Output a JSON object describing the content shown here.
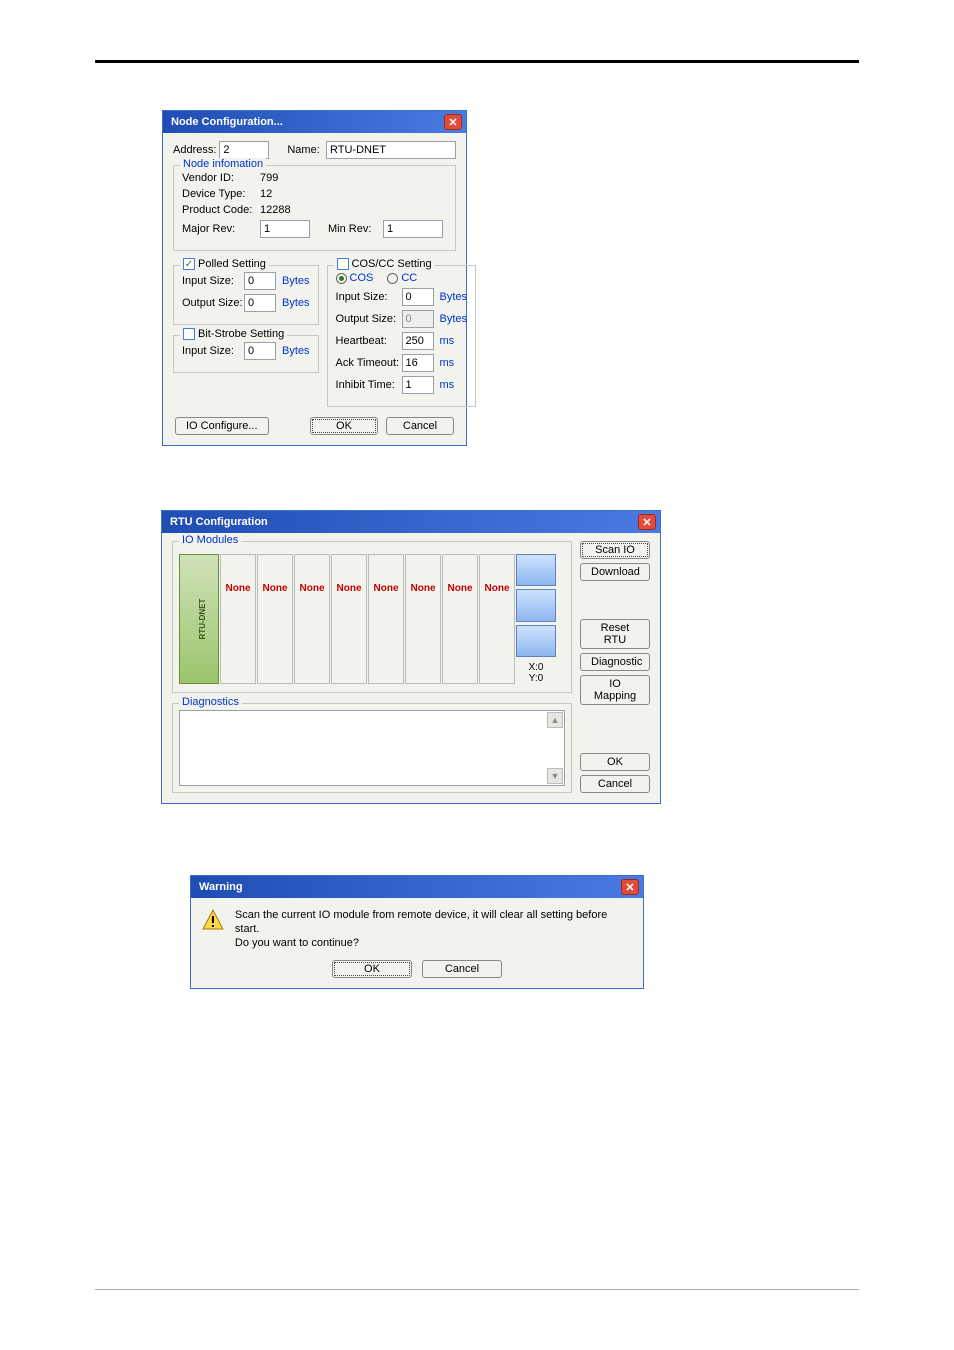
{
  "nodecfg": {
    "title": "Node Configuration...",
    "addressLabel": "Address:",
    "addressValue": "2",
    "nameLabel": "Name:",
    "nameValue": "RTU-DNET",
    "nodeInfoLegend": "Node infomation",
    "vendorIdLabel": "Vendor ID:",
    "vendorIdValue": "799",
    "deviceTypeLabel": "Device Type:",
    "deviceTypeValue": "12",
    "productCodeLabel": "Product Code:",
    "productCodeValue": "12288",
    "majorRevLabel": "Major Rev:",
    "majorRevValue": "1",
    "minRevLabel": "Min Rev:",
    "minRevValue": "1",
    "polled": {
      "legend": "Polled Setting",
      "checked": true,
      "inputSizeLabel": "Input Size:",
      "inputSizeValue": "0",
      "outputSizeLabel": "Output Size:",
      "outputSizeValue": "0",
      "unit": "Bytes"
    },
    "bitstrobe": {
      "legend": "Bit-Strobe Setting",
      "checked": false,
      "inputSizeLabel": "Input Size:",
      "inputSizeValue": "0",
      "unit": "Bytes"
    },
    "coscc": {
      "legend": "COS/CC Setting",
      "checked": false,
      "cosLabel": "COS",
      "ccLabel": "CC",
      "cosSelected": true,
      "inputSizeLabel": "Input Size:",
      "inputSizeValue": "0",
      "outputSizeLabel": "Output Size:",
      "outputSizeValue": "0",
      "unit": "Bytes",
      "heartbeatLabel": "Heartbeat:",
      "heartbeatValue": "250",
      "ackLabel": "Ack Timeout:",
      "ackValue": "16",
      "inhibitLabel": "Inhibit Time:",
      "inhibitValue": "1",
      "msUnit": "ms"
    },
    "ioConfigureLabel": "IO Configure...",
    "okLabel": "OK",
    "cancelLabel": "Cancel"
  },
  "rtucfg": {
    "title": "RTU Configuration",
    "ioModulesLegend": "IO Modules",
    "slotPlaceholder": "None",
    "deviceVert": "RTU-DNET",
    "xLabel": "X:0",
    "yLabel": "Y:0",
    "diagnosticsLegend": "Diagnostics",
    "btns": {
      "scanIO": "Scan IO",
      "download": "Download",
      "resetRTU": "Reset RTU",
      "diagnostic": "Diagnostic",
      "ioMapping": "IO Mapping",
      "ok": "OK",
      "cancel": "Cancel"
    }
  },
  "warn": {
    "title": "Warning",
    "line1": "Scan the current IO module from remote device, it will clear all setting before start.",
    "line2": "Do you want to continue?",
    "ok": "OK",
    "cancel": "Cancel"
  }
}
